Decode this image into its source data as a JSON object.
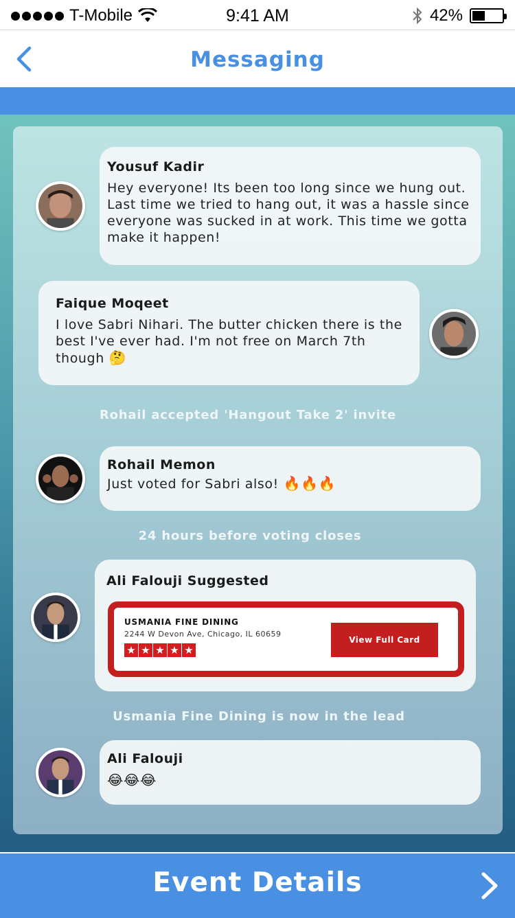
{
  "status_bar": {
    "carrier": "T-Mobile",
    "time": "9:41 AM",
    "battery": "42%",
    "battery_level": 0.42,
    "icons": [
      "signal-dots-icon",
      "wifi-icon",
      "bluetooth-icon",
      "battery-icon"
    ]
  },
  "nav": {
    "title": "Messaging",
    "back_icon": "chevron-left-icon"
  },
  "messages": [
    {
      "sender": "Yousuf Kadir",
      "text": "Hey everyone! Its been too long since we hung out. Last time we tried to hang out, it was a hassle since everyone was sucked in at work. This time we gotta make it happen!"
    },
    {
      "sender": "Faique Moqeet",
      "text": "I love Sabri Nihari. The butter chicken there is the best I've ever had. I'm not free on March 7th though",
      "emoji": "🤔"
    },
    {
      "system": "Rohail accepted 'Hangout Take 2' invite"
    },
    {
      "sender": "Rohail Memon",
      "text": "Just voted for Sabri also!",
      "emoji": "🔥🔥🔥"
    },
    {
      "system": "24 hours before voting closes"
    },
    {
      "sender": "Ali Falouji Suggested",
      "card": {
        "name": "USMANIA FINE DINING",
        "address": "2244 W Devon Ave, Chicago, IL 60659",
        "rating": 5,
        "button_label": "View Full Card"
      }
    },
    {
      "system": "Usmania Fine Dining is now in the lead"
    },
    {
      "sender": "Ali Falouji",
      "emoji": "😂😂😂"
    }
  ],
  "footer": {
    "label": "Event Details",
    "icon": "chevron-right-icon"
  },
  "colors": {
    "brand_blue": "#4a90e2",
    "card_red": "#c41f1f"
  }
}
